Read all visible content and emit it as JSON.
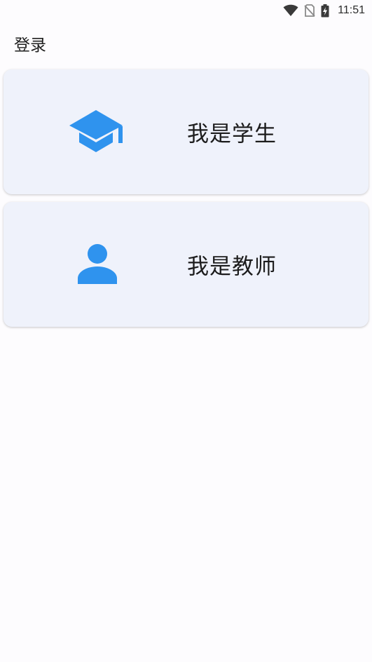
{
  "status_bar": {
    "time": "11:51",
    "icons": [
      "wifi-icon",
      "no-sim-icon",
      "battery-charging-icon"
    ]
  },
  "app_bar": {
    "title": "登录"
  },
  "options": [
    {
      "label": "我是学生",
      "icon": "graduation-cap-icon"
    },
    {
      "label": "我是教师",
      "icon": "person-icon"
    }
  ],
  "colors": {
    "accent": "#2f93ee",
    "card_bg": "#eff2fb",
    "page_bg": "#fdfcfe"
  }
}
